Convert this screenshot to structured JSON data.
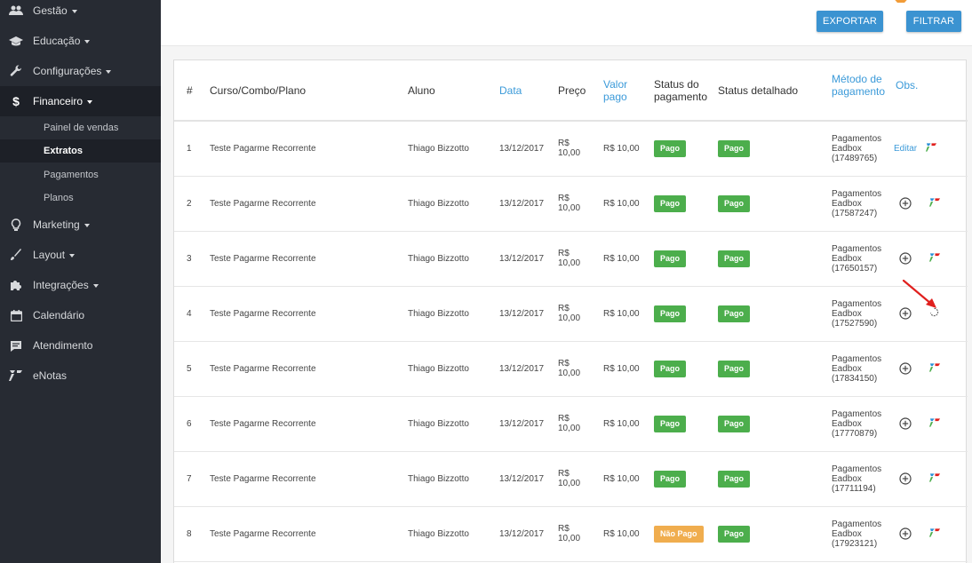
{
  "sidebar": {
    "items": [
      {
        "label": "Gestão",
        "icon": "people-icon",
        "dropdown": true
      },
      {
        "label": "Educação",
        "icon": "graduation-cap-icon",
        "dropdown": true
      },
      {
        "label": "Configurações",
        "icon": "wrench-icon",
        "dropdown": true
      },
      {
        "label": "Financeiro",
        "icon": "dollar-icon",
        "dropdown": true,
        "active": true
      },
      {
        "label": "Marketing",
        "icon": "lightbulb-icon",
        "dropdown": true
      },
      {
        "label": "Layout",
        "icon": "brush-icon",
        "dropdown": true
      },
      {
        "label": "Integrações",
        "icon": "puzzle-icon",
        "dropdown": true
      },
      {
        "label": "Calendário",
        "icon": "calendar-icon",
        "dropdown": false
      },
      {
        "label": "Atendimento",
        "icon": "chat-icon",
        "dropdown": false
      },
      {
        "label": "eNotas",
        "icon": "enotas-icon",
        "dropdown": false
      }
    ],
    "subitems": [
      {
        "label": "Painel de vendas"
      },
      {
        "label": "Extratos",
        "active": true
      },
      {
        "label": "Pagamentos"
      },
      {
        "label": "Planos"
      }
    ]
  },
  "toolbar": {
    "export_label": "EXPORTAR",
    "filter_label": "FILTRAR"
  },
  "table": {
    "headers": {
      "num": "#",
      "course": "Curso/Combo/Plano",
      "student": "Aluno",
      "date": "Data",
      "price": "Preço",
      "paid_1": "Valor",
      "paid_2": "pago",
      "status_1": "Status do",
      "status_2": "pagamento",
      "detail": "Status detalhado",
      "method_1": "Método de",
      "method_2": "pagamento",
      "obs": "Obs."
    },
    "rows": [
      {
        "num": "1",
        "course": "Teste Pagarme Recorrente",
        "student": "Thiago Bizzotto",
        "date": "13/12/2017",
        "price_1": "R$",
        "price_2": "10,00",
        "paid": "R$ 10,00",
        "status": "Pago",
        "status_color": "green",
        "detail": "Pago",
        "method_1": "Pagamentos",
        "method_2": "Eadbox",
        "method_3": "(17489765)",
        "obs": "Editar",
        "obs_type": "link",
        "flag": "enotas-icon"
      },
      {
        "num": "2",
        "course": "Teste Pagarme Recorrente",
        "student": "Thiago Bizzotto",
        "date": "13/12/2017",
        "price_1": "R$",
        "price_2": "10,00",
        "paid": "R$ 10,00",
        "status": "Pago",
        "status_color": "green",
        "detail": "Pago",
        "method_1": "Pagamentos",
        "method_2": "Eadbox",
        "method_3": "(17587247)",
        "obs": "plus-circle-icon",
        "obs_type": "icon",
        "flag": "enotas-icon"
      },
      {
        "num": "3",
        "course": "Teste Pagarme Recorrente",
        "student": "Thiago Bizzotto",
        "date": "13/12/2017",
        "price_1": "R$",
        "price_2": "10,00",
        "paid": "R$ 10,00",
        "status": "Pago",
        "status_color": "green",
        "detail": "Pago",
        "method_1": "Pagamentos",
        "method_2": "Eadbox",
        "method_3": "(17650157)",
        "obs": "plus-circle-icon",
        "obs_type": "icon",
        "flag": "enotas-icon"
      },
      {
        "num": "4",
        "course": "Teste Pagarme Recorrente",
        "student": "Thiago Bizzotto",
        "date": "13/12/2017",
        "price_1": "R$",
        "price_2": "10,00",
        "paid": "R$ 10,00",
        "status": "Pago",
        "status_color": "green",
        "detail": "Pago",
        "method_1": "Pagamentos",
        "method_2": "Eadbox",
        "method_3": "(17527590)",
        "obs": "plus-circle-icon",
        "obs_type": "icon",
        "flag": "loading-spinner-icon"
      },
      {
        "num": "5",
        "course": "Teste Pagarme Recorrente",
        "student": "Thiago Bizzotto",
        "date": "13/12/2017",
        "price_1": "R$",
        "price_2": "10,00",
        "paid": "R$ 10,00",
        "status": "Pago",
        "status_color": "green",
        "detail": "Pago",
        "method_1": "Pagamentos",
        "method_2": "Eadbox",
        "method_3": "(17834150)",
        "obs": "plus-circle-icon",
        "obs_type": "icon",
        "flag": "enotas-icon"
      },
      {
        "num": "6",
        "course": "Teste Pagarme Recorrente",
        "student": "Thiago Bizzotto",
        "date": "13/12/2017",
        "price_1": "R$",
        "price_2": "10,00",
        "paid": "R$ 10,00",
        "status": "Pago",
        "status_color": "green",
        "detail": "Pago",
        "method_1": "Pagamentos",
        "method_2": "Eadbox",
        "method_3": "(17770879)",
        "obs": "plus-circle-icon",
        "obs_type": "icon",
        "flag": "enotas-icon"
      },
      {
        "num": "7",
        "course": "Teste Pagarme Recorrente",
        "student": "Thiago Bizzotto",
        "date": "13/12/2017",
        "price_1": "R$",
        "price_2": "10,00",
        "paid": "R$ 10,00",
        "status": "Pago",
        "status_color": "green",
        "detail": "Pago",
        "method_1": "Pagamentos",
        "method_2": "Eadbox",
        "method_3": "(17711194)",
        "obs": "plus-circle-icon",
        "obs_type": "icon",
        "flag": "enotas-icon"
      },
      {
        "num": "8",
        "course": "Teste Pagarme Recorrente",
        "student": "Thiago Bizzotto",
        "date": "13/12/2017",
        "price_1": "R$",
        "price_2": "10,00",
        "paid": "R$ 10,00",
        "status": "Não Pago",
        "status_color": "orange",
        "detail": "Pago",
        "method_1": "Pagamentos",
        "method_2": "Eadbox",
        "method_3": "(17923121)",
        "obs": "plus-circle-icon",
        "obs_type": "icon",
        "flag": "enotas-icon"
      }
    ]
  },
  "colors": {
    "sidebar_bg": "#272b33",
    "accent_blue": "#3b93d1",
    "header_blue": "#3b9ad9",
    "badge_green": "#4cae4c",
    "badge_orange": "#f0ad4e",
    "annotation_red": "#e0201e"
  }
}
